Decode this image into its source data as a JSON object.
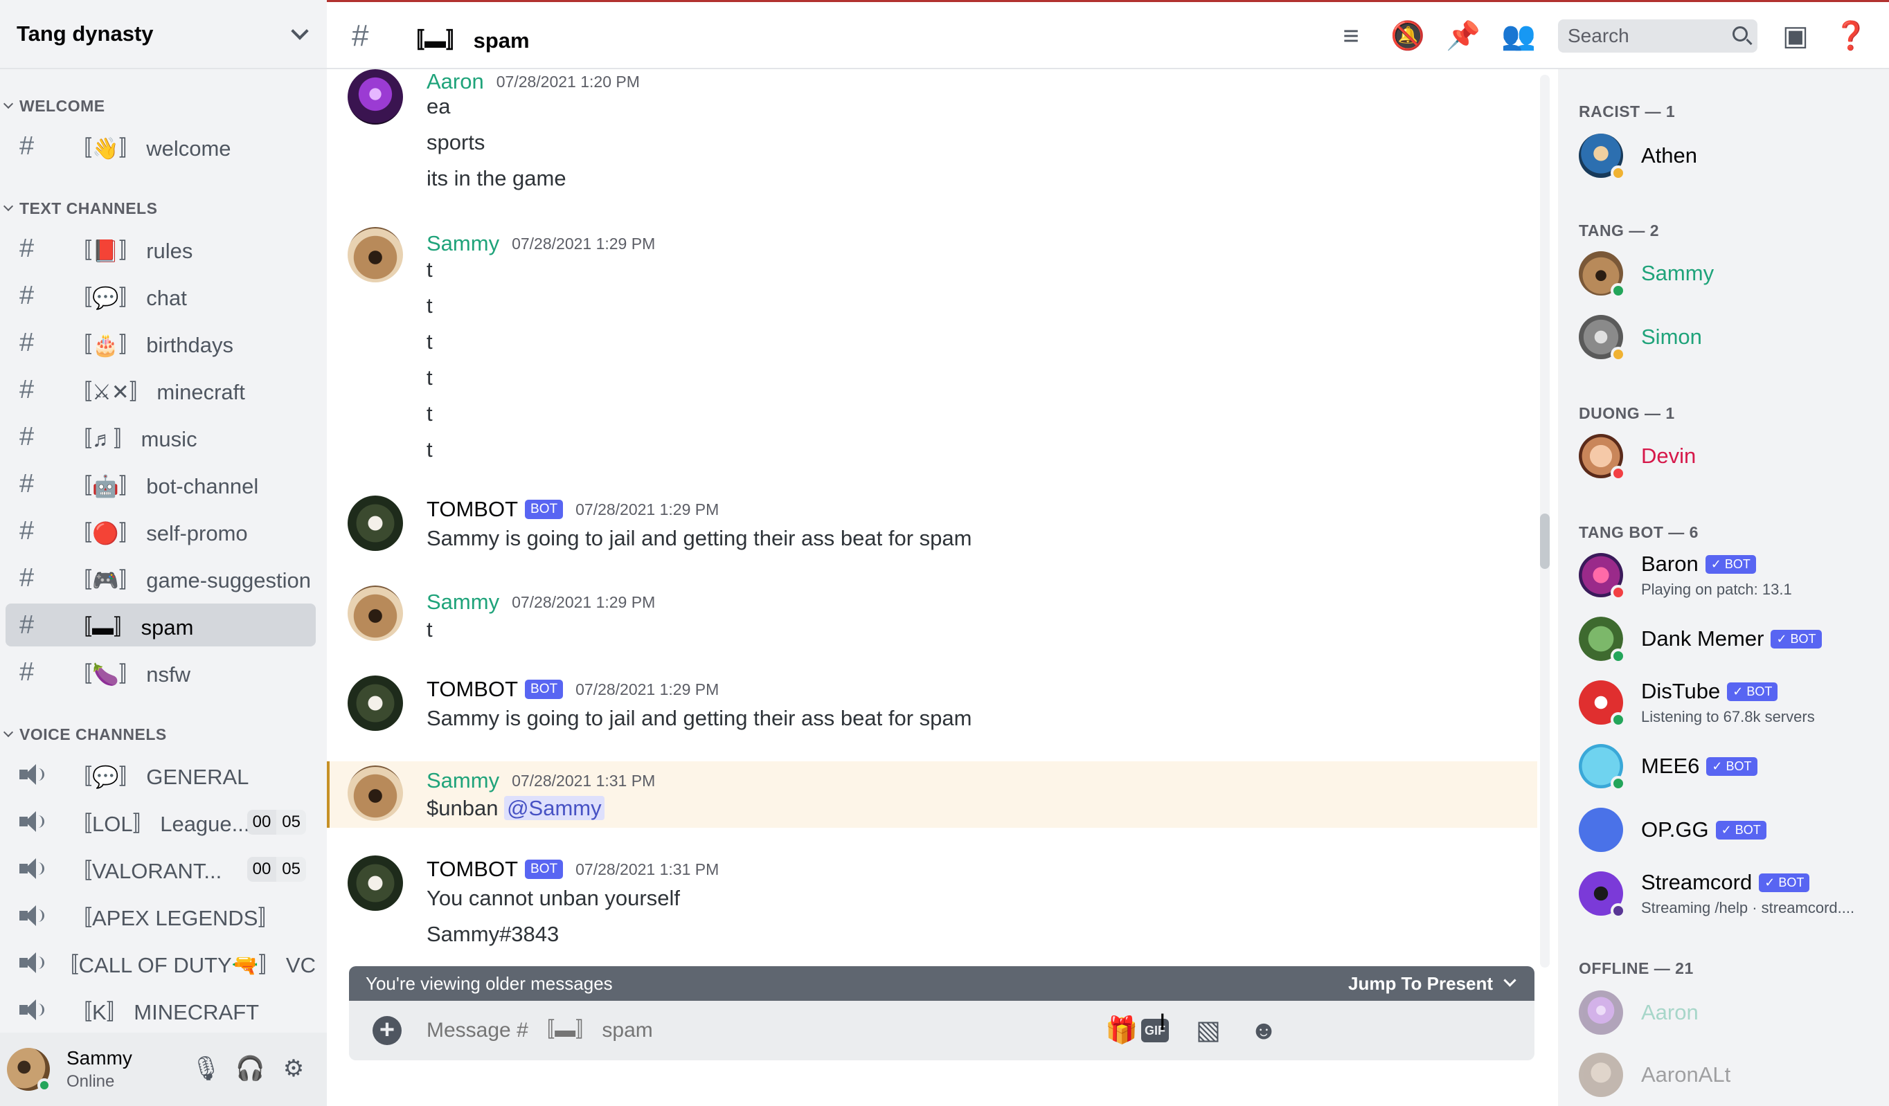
{
  "server": {
    "name": "Tang dynasty"
  },
  "categories": {
    "welcome": "WELCOME",
    "text": "TEXT CHANNELS",
    "voice": "VOICE CHANNELS"
  },
  "channels": {
    "welcome": [
      {
        "label": "〚👋〛 welcome"
      }
    ],
    "text": [
      {
        "label": "〚📕〛 rules"
      },
      {
        "label": "〚💬〛 chat"
      },
      {
        "label": "〚🎂〛 birthdays"
      },
      {
        "label": "〚⚔✕〛 minecraft"
      },
      {
        "label": "〚♬〛 music"
      },
      {
        "label": "〚🤖〛 bot-channel"
      },
      {
        "label": "〚🔴〛 self-promo"
      },
      {
        "label": "〚🎮〛 game-suggestion"
      },
      {
        "label": "〚▬〛 spam"
      },
      {
        "label": "〚🍆〛 nsfw"
      }
    ],
    "voice": [
      {
        "label": "〚💬〛 GENERAL"
      },
      {
        "label": "〚LOL〛 League...",
        "count_a": "00",
        "count_b": "05"
      },
      {
        "label": "〚VALORANT...",
        "count_a": "00",
        "count_b": "05"
      },
      {
        "label": "〚APEX LEGENDS〛"
      },
      {
        "label": "〚CALL OF DUTY🔫〛 VC"
      },
      {
        "label": "〚K〛 MINECRAFT"
      }
    ]
  },
  "user": {
    "name": "Sammy",
    "status": "Online"
  },
  "topbar": {
    "channel": "〚▬〛 spam",
    "search_placeholder": "Search"
  },
  "messages": [
    {
      "author": "Aaron",
      "time": "07/28/2021 1:20 PM",
      "lines": [
        "ea",
        "sports",
        "its in the game"
      ]
    },
    {
      "author": "Sammy",
      "time": "07/28/2021 1:29 PM",
      "lines": [
        "t",
        "t",
        "t",
        "t",
        "t",
        "t"
      ]
    },
    {
      "author": "TOMBOT",
      "badge": "BOT",
      "time": "07/28/2021 1:29 PM",
      "lines": [
        "Sammy is going to jail and getting their ass beat for spam"
      ]
    },
    {
      "author": "Sammy",
      "time": "07/28/2021 1:29 PM",
      "lines": [
        "t"
      ]
    },
    {
      "author": "TOMBOT",
      "badge": "BOT",
      "time": "07/28/2021 1:29 PM",
      "lines": [
        "Sammy is going to jail and getting their ass beat for spam"
      ]
    },
    {
      "author": "Sammy",
      "time": "07/28/2021 1:31 PM",
      "lines": [
        "$unban"
      ],
      "mention": "@Sammy"
    },
    {
      "author": "TOMBOT",
      "badge": "BOT",
      "time": "07/28/2021 1:31 PM",
      "lines": [
        "You cannot unban yourself",
        "Sammy#3843"
      ]
    }
  ],
  "older_bar": {
    "text": "You're viewing older messages",
    "jump": "Jump To Present"
  },
  "composer": {
    "placeholder": "Message # 〚▬〛 spam"
  },
  "members": {
    "groups": [
      {
        "title": "RACIST — 1",
        "members": [
          {
            "name": "Athen"
          }
        ]
      },
      {
        "title": "TANG — 2",
        "members": [
          {
            "name": "Sammy"
          },
          {
            "name": "Simon"
          }
        ]
      },
      {
        "title": "DUONG — 1",
        "members": [
          {
            "name": "Devin"
          }
        ]
      },
      {
        "title": "TANG BOT — 6",
        "members": [
          {
            "name": "Baron",
            "badge": "✓ BOT",
            "activity": "Playing on patch: 13.1"
          },
          {
            "name": "Dank Memer",
            "badge": "✓ BOT"
          },
          {
            "name": "DisTube",
            "badge": "✓ BOT",
            "activity": "Listening to 67.8k servers"
          },
          {
            "name": "MEE6",
            "badge": "✓ BOT"
          },
          {
            "name": "OP.GG",
            "badge": "✓ BOT"
          },
          {
            "name": "Streamcord",
            "badge": "✓ BOT",
            "activity": "Streaming /help · streamcord...."
          }
        ]
      },
      {
        "title": "OFFLINE — 21",
        "members": [
          {
            "name": "Aaron"
          },
          {
            "name": "AaronALt"
          }
        ]
      }
    ]
  },
  "colors": {
    "accent": "#5865f2",
    "green_name": "#1fa37a",
    "devin_name": "#d6184a",
    "highlight": "#fdf5e8"
  },
  "icons": [
    "threads-icon",
    "mute-bell-icon",
    "pin-icon",
    "members-icon",
    "search-icon",
    "inbox-icon",
    "help-icon",
    "mic-icon",
    "headphones-icon",
    "gear-icon",
    "plus-icon",
    "gift-icon",
    "gif-icon",
    "sticker-icon",
    "emoji-icon"
  ]
}
